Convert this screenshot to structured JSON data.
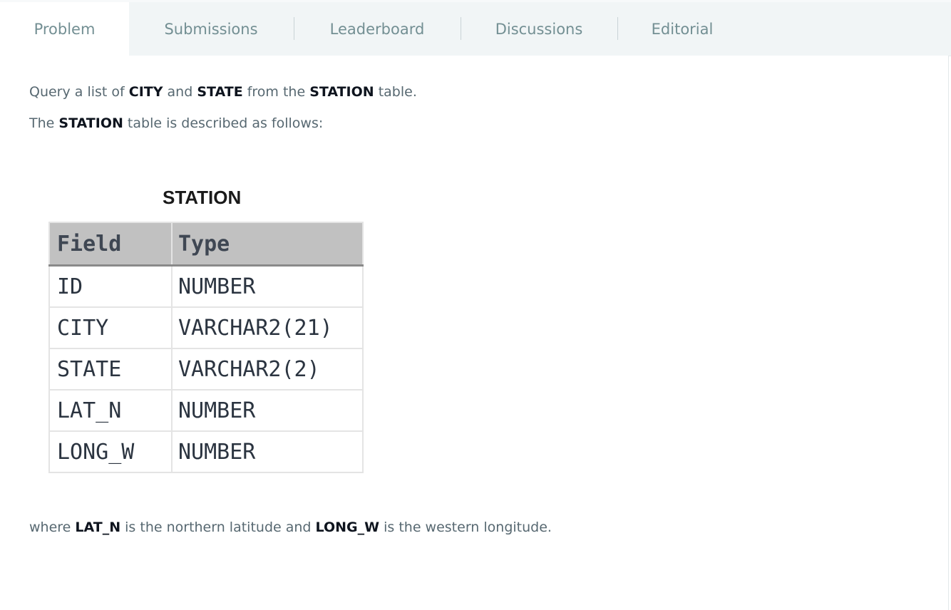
{
  "tabs": [
    {
      "label": "Problem",
      "active": true
    },
    {
      "label": "Submissions"
    },
    {
      "label": "Leaderboard"
    },
    {
      "label": "Discussions"
    },
    {
      "label": "Editorial"
    }
  ],
  "intro": {
    "l1": {
      "a": "Query a list of ",
      "b1": "CITY",
      "c": " and ",
      "b2": "STATE",
      "d": " from the ",
      "b3": "STATION",
      "e": " table."
    },
    "l2": {
      "a": "The ",
      "b1": "STATION",
      "c": " table is described as follows:"
    }
  },
  "table": {
    "title": "STATION",
    "headers": [
      "Field",
      "Type"
    ],
    "rows": [
      [
        "ID",
        "NUMBER"
      ],
      [
        "CITY",
        "VARCHAR2(21)"
      ],
      [
        "STATE",
        "VARCHAR2(2)"
      ],
      [
        "LAT_N",
        "NUMBER"
      ],
      [
        "LONG_W",
        "NUMBER"
      ]
    ]
  },
  "footer": {
    "a": "where ",
    "b1": "LAT_N",
    "c": " is the northern latitude and ",
    "b2": "LONG_W",
    "d": " is the western longitude."
  }
}
